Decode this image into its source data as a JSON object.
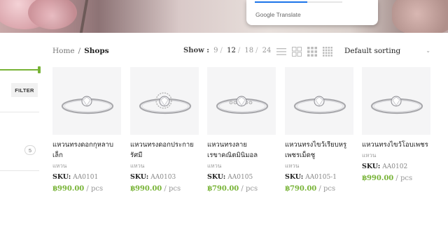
{
  "translate_popup": {
    "brand": "Google Translate",
    "progress": 0.6
  },
  "sidebar": {
    "filter_label": "FILTER",
    "count": "5"
  },
  "breadcrumb": {
    "home": "Home",
    "separator": "/",
    "current": "Shops"
  },
  "show": {
    "label": "Show :",
    "options": [
      "9",
      "12",
      "18",
      "24"
    ],
    "selected": "12",
    "divider": "/"
  },
  "view_icons": [
    "list-view-icon",
    "grid-2-view-icon",
    "grid-3-view-icon",
    "grid-4-view-icon"
  ],
  "sorting": {
    "selected": "Default sorting",
    "chevron": "⌄"
  },
  "sku_label": "SKU:",
  "unit_label": "/ pcs",
  "accent_color": "#77b336",
  "products": [
    {
      "name": "แหวนทรงดอกกุหลาบเล็ก",
      "category": "แหวน",
      "sku": "AA0101",
      "price": "฿990.00"
    },
    {
      "name": "แหวนทรงดอกประกายรัศมี",
      "category": "แหวน",
      "sku": "AA0103",
      "price": "฿990.00"
    },
    {
      "name": "แหวนทรงลายเรขาคณิตมินิมอล",
      "category": "แหวน",
      "sku": "AA0105",
      "price": "฿790.00"
    },
    {
      "name": "แหวนทรงไขว้เรียบหรูเพชรเม็ดชู",
      "category": "แหวน",
      "sku": "AA0105-1",
      "price": "฿790.00"
    },
    {
      "name": "แหวนทรงไขว้โอบเพชร",
      "category": "แหวน",
      "sku": "AA0102",
      "price": "฿990.00"
    }
  ]
}
